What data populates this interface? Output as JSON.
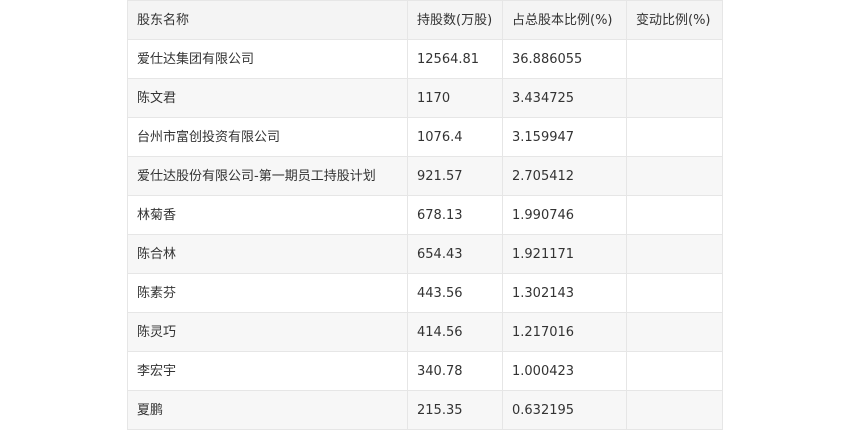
{
  "table": {
    "headers": [
      "股东名称",
      "持股数(万股)",
      "占总股本比例(%)",
      "变动比例(%)"
    ],
    "rows": [
      [
        "爱仕达集团有限公司",
        "12564.81",
        "36.886055",
        ""
      ],
      [
        "陈文君",
        "1170",
        "3.434725",
        ""
      ],
      [
        "台州市富创投资有限公司",
        "1076.4",
        "3.159947",
        ""
      ],
      [
        "爱仕达股份有限公司-第一期员工持股计划",
        "921.57",
        "2.705412",
        ""
      ],
      [
        "林菊香",
        "678.13",
        "1.990746",
        ""
      ],
      [
        "陈合林",
        "654.43",
        "1.921171",
        ""
      ],
      [
        "陈素芬",
        "443.56",
        "1.302143",
        ""
      ],
      [
        "陈灵巧",
        "414.56",
        "1.217016",
        ""
      ],
      [
        "李宏宇",
        "340.78",
        "1.000423",
        ""
      ],
      [
        "夏鹏",
        "215.35",
        "0.632195",
        ""
      ]
    ]
  }
}
